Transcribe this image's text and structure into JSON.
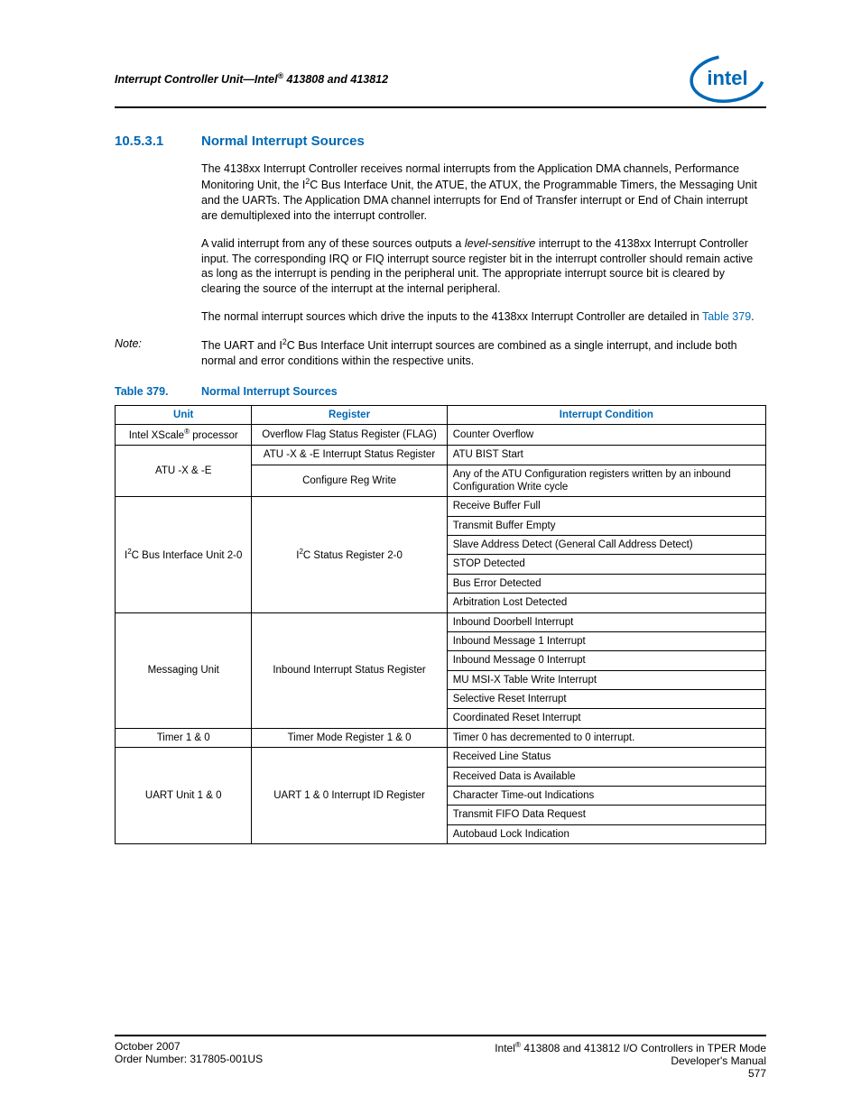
{
  "header": {
    "title_prefix": "Interrupt Controller Unit—Intel",
    "title_suffix": " 413808 and 413812"
  },
  "section": {
    "num": "10.5.3.1",
    "title": "Normal Interrupt Sources",
    "p1_a": "The 4138xx Interrupt Controller receives normal interrupts from the Application DMA channels, Performance Monitoring Unit, the I",
    "p1_b": "C Bus Interface Unit, the ATUE, the ATUX, the Programmable Timers, the Messaging Unit and the UARTs. The Application DMA channel interrupts for End of Transfer interrupt or End of Chain interrupt are demultiplexed into the interrupt controller.",
    "p2_a": "A valid interrupt from any of these sources outputs a ",
    "p2_em": "level-sensitive",
    "p2_b": " interrupt to the 4138xx Interrupt Controller input. The corresponding IRQ or FIQ interrupt source register bit in the interrupt controller should remain active as long as the interrupt is pending in the peripheral unit. The appropriate interrupt source bit is cleared by clearing the source of the interrupt at the internal peripheral.",
    "p3_a": "The normal interrupt sources which drive the inputs to the 4138xx Interrupt Controller are detailed in ",
    "p3_link": "Table 379",
    "p3_b": "."
  },
  "note": {
    "label": "Note:",
    "body_a": "The UART and I",
    "body_b": "C Bus Interface Unit interrupt sources are combined as a single interrupt, and include both normal and error conditions within the respective units."
  },
  "table": {
    "label": "Table 379.",
    "title": "Normal Interrupt Sources",
    "headers": {
      "h1": "Unit",
      "h2": "Register",
      "h3": "Interrupt Condition"
    },
    "rows": {
      "r1_unit_a": "Intel XScale",
      "r1_unit_b": " processor",
      "r1_reg": "Overflow Flag Status Register (FLAG)",
      "r1_cond": "Counter Overflow",
      "r2_unit": "ATU -X & -E",
      "r2_reg": "ATU -X & -E Interrupt Status Register",
      "r2_cond": "ATU BIST Start",
      "r3_reg": "Configure Reg Write",
      "r3_cond": "Any of the ATU Configuration registers written by an inbound Configuration Write cycle",
      "r4_unit_a": "I",
      "r4_unit_b": "C Bus Interface Unit 2-0",
      "r4_reg_a": "I",
      "r4_reg_b": "C Status Register 2-0",
      "r4_c1": "Receive Buffer Full",
      "r4_c2": "Transmit Buffer Empty",
      "r4_c3": "Slave Address Detect (General Call Address Detect)",
      "r4_c4": "STOP Detected",
      "r4_c5": "Bus Error Detected",
      "r4_c6": "Arbitration Lost Detected",
      "r5_unit": "Messaging Unit",
      "r5_reg": "Inbound Interrupt Status Register",
      "r5_c1": "Inbound Doorbell Interrupt",
      "r5_c2": "Inbound Message 1 Interrupt",
      "r5_c3": "Inbound Message 0 Interrupt",
      "r5_c4": "MU MSI-X Table Write Interrupt",
      "r5_c5": "Selective Reset Interrupt",
      "r5_c6": "Coordinated Reset Interrupt",
      "r6_unit": "Timer 1 & 0",
      "r6_reg": "Timer Mode Register 1 & 0",
      "r6_cond": "Timer 0 has decremented to 0 interrupt.",
      "r7_unit": "UART Unit 1 & 0",
      "r7_reg": "UART 1 & 0 Interrupt ID Register",
      "r7_c1": "Received Line Status",
      "r7_c2": "Received Data is Available",
      "r7_c3": "Character Time-out Indications",
      "r7_c4": "Transmit FIFO Data Request",
      "r7_c5": "Autobaud Lock Indication"
    }
  },
  "footer": {
    "left1": "October 2007",
    "left2": "Order Number: 317805-001US",
    "right1_a": "Intel",
    "right1_b": " 413808 and 413812 I/O Controllers in TPER Mode",
    "right2": "Developer's Manual",
    "right3": "577"
  },
  "glyph": {
    "two": "2",
    "reg": "®"
  }
}
